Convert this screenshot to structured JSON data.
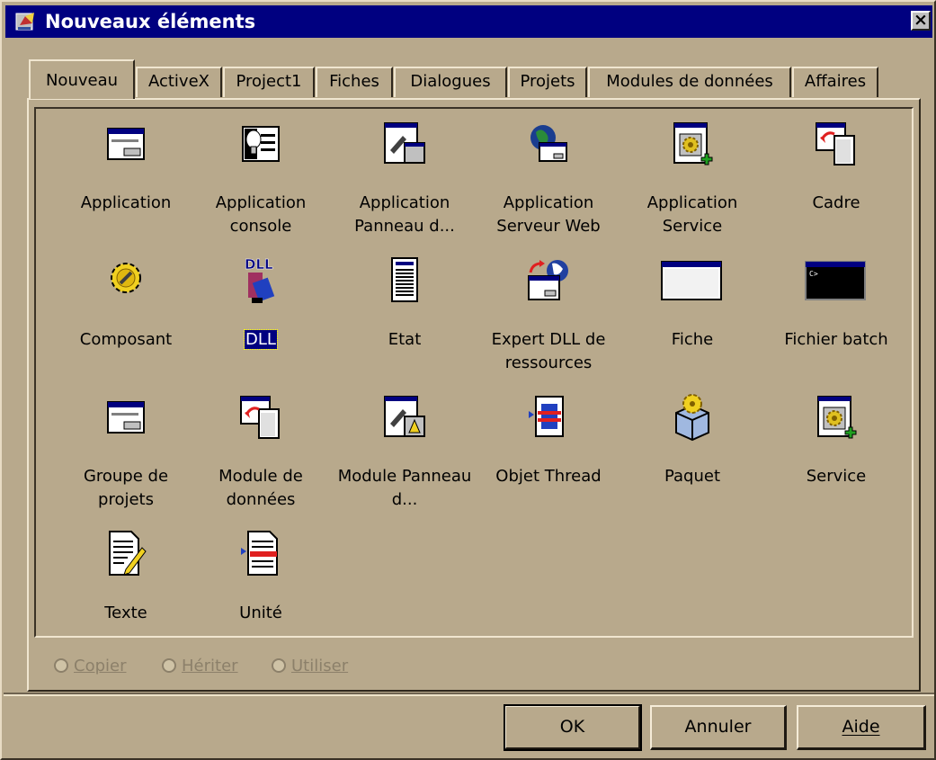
{
  "window": {
    "title": "Nouveaux éléments",
    "close": "×"
  },
  "tabs": [
    {
      "label": "Nouveau",
      "active": true
    },
    {
      "label": "ActiveX"
    },
    {
      "label": "Project1"
    },
    {
      "label": "Fiches"
    },
    {
      "label": "Dialogues"
    },
    {
      "label": "Projets"
    },
    {
      "label": "Modules de données"
    },
    {
      "label": "Affaires"
    }
  ],
  "items": [
    {
      "label": "Application",
      "icon": "application-icon"
    },
    {
      "label": "Application console",
      "icon": "console-application-icon"
    },
    {
      "label": "Application Panneau d...",
      "icon": "control-panel-application-icon"
    },
    {
      "label": "Application Serveur Web",
      "icon": "web-server-application-icon"
    },
    {
      "label": "Application Service",
      "icon": "service-application-icon"
    },
    {
      "label": "Cadre",
      "icon": "frame-icon"
    },
    {
      "label": "Composant",
      "icon": "component-gear-icon"
    },
    {
      "label": "DLL",
      "icon": "dll-icon",
      "selected": true
    },
    {
      "label": "Etat",
      "icon": "report-icon"
    },
    {
      "label": "Expert DLL de ressources",
      "icon": "resource-dll-wizard-icon"
    },
    {
      "label": "Fiche",
      "icon": "form-icon"
    },
    {
      "label": "Fichier batch",
      "icon": "batch-file-icon"
    },
    {
      "label": "Groupe de projets",
      "icon": "project-group-icon"
    },
    {
      "label": "Module de données",
      "icon": "data-module-icon"
    },
    {
      "label": "Module Panneau d...",
      "icon": "control-panel-module-icon"
    },
    {
      "label": "Objet Thread",
      "icon": "thread-object-icon"
    },
    {
      "label": "Paquet",
      "icon": "package-icon"
    },
    {
      "label": "Service",
      "icon": "service-icon"
    },
    {
      "label": "Texte",
      "icon": "text-file-icon"
    },
    {
      "label": "Unité",
      "icon": "unit-icon"
    }
  ],
  "options": {
    "copy": "Copier",
    "inherit": "Hériter",
    "use": "Utiliser",
    "enabled": false
  },
  "buttons": {
    "ok": "OK",
    "cancel": "Annuler",
    "help": "Aide"
  },
  "colors": {
    "face": "#b8a98c",
    "titlebar": "#000080",
    "selection": "#000080",
    "disabled_text": "#8c806a"
  }
}
